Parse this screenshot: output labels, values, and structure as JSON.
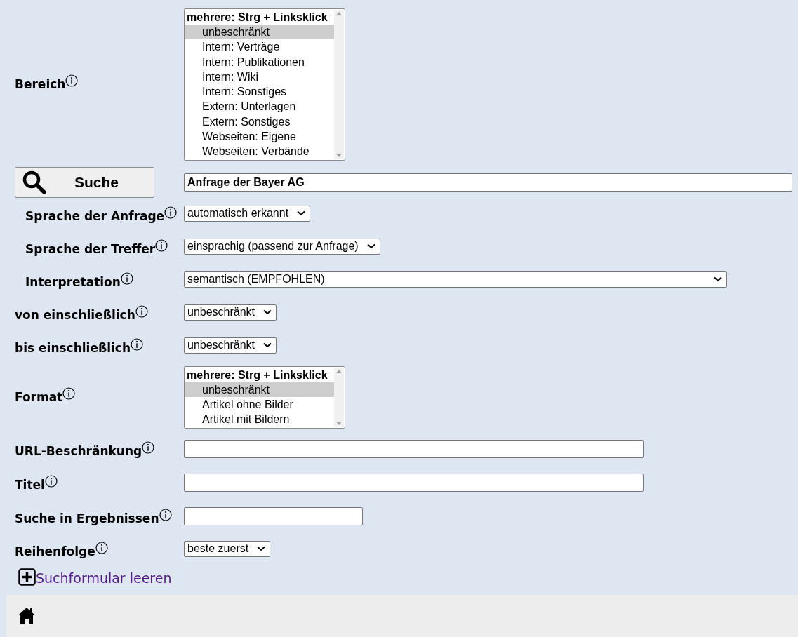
{
  "fields": [
    {
      "kind": "listbox",
      "label": "Bereich",
      "hint": "mehrere: Strg + Linksklick",
      "options": [
        {
          "text": "unbeschränkt",
          "selected": true
        },
        {
          "text": "Intern: Verträge",
          "selected": false
        },
        {
          "text": "Intern: Publikationen",
          "selected": false
        },
        {
          "text": "Intern: Wiki",
          "selected": false
        },
        {
          "text": "Intern: Sonstiges",
          "selected": false
        },
        {
          "text": "Extern: Unterlagen",
          "selected": false
        },
        {
          "text": "Extern: Sonstiges",
          "selected": false
        },
        {
          "text": "Webseiten: Eigene",
          "selected": false
        },
        {
          "text": "Webseiten: Verbände",
          "selected": false
        }
      ]
    },
    {
      "kind": "search",
      "button": "Suche",
      "value": "Anfrage der Bayer AG",
      "children": [
        {
          "kind": "dropdown",
          "label": "Sprache der Anfrage",
          "value": "automatisch erkannt"
        },
        {
          "kind": "dropdown",
          "label": "Sprache der Treffer",
          "value": "einsprachig (passend zur Anfrage)"
        },
        {
          "kind": "wide-dropdown",
          "label": "Interpretation",
          "value": "semantisch (EMPFOHLEN)"
        }
      ]
    },
    {
      "kind": "dropdown",
      "label": "von einschließlich",
      "value": "unbeschränkt"
    },
    {
      "kind": "dropdown",
      "label": "bis einschließlich",
      "value": "unbeschränkt"
    },
    {
      "kind": "listbox",
      "label": "Format",
      "hint": "mehrere: Strg + Linksklick",
      "options": [
        {
          "text": "unbeschränkt",
          "selected": true
        },
        {
          "text": "Artikel ohne Bilder",
          "selected": false
        },
        {
          "text": "Artikel mit Bildern",
          "selected": false
        }
      ]
    },
    {
      "kind": "text",
      "label": "URL-Beschränkung"
    },
    {
      "kind": "text",
      "label": "Titel"
    },
    {
      "kind": "short-text",
      "label": "Suche in Ergebnissen"
    },
    {
      "kind": "dropdown",
      "label": "Reihenfolge",
      "value": "beste zuerst"
    }
  ],
  "reset_link": "Suchformular leeren"
}
